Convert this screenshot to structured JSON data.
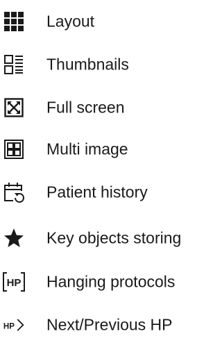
{
  "menu": {
    "items": [
      {
        "label": "Layout",
        "icon": "grid-icon"
      },
      {
        "label": "Thumbnails",
        "icon": "thumbnails-icon"
      },
      {
        "label": "Full screen",
        "icon": "fullscreen-icon"
      },
      {
        "label": "Multi image",
        "icon": "multi-image-icon"
      },
      {
        "label": "Patient history",
        "icon": "patient-history-icon"
      },
      {
        "label": "Key objects storing",
        "icon": "star-icon"
      },
      {
        "label": "Hanging protocols",
        "icon": "hanging-protocols-icon"
      },
      {
        "label": "Next/Previous HP",
        "icon": "next-previous-hp-icon"
      }
    ],
    "icon_color": "#1a1a1a",
    "text_color": "#1a1a1a",
    "icon_text": {
      "hanging_protocols": "HP",
      "next_previous": "HP"
    }
  }
}
